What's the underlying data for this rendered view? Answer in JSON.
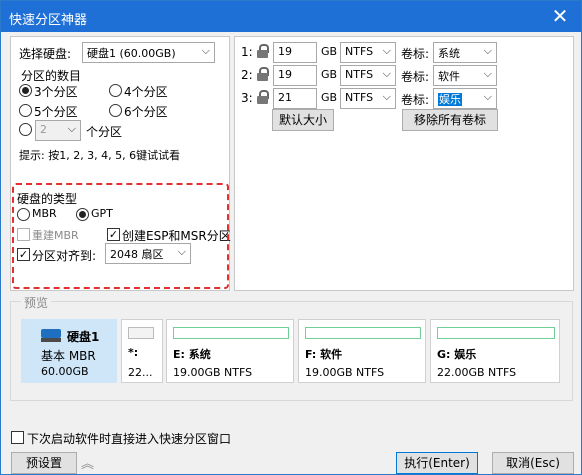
{
  "window": {
    "title": "快速分区神器",
    "close_glyph": "✕"
  },
  "disk_select": {
    "label": "选择硬盘:",
    "value": "硬盘1 (60.00GB)"
  },
  "count": {
    "label": "分区的数目",
    "options": [
      "3个分区",
      "4个分区",
      "5个分区",
      "6个分区"
    ],
    "custom_value": "2",
    "custom_suffix": "个分区",
    "hint": "提示: 按1, 2, 3, 4, 5, 6键试试看"
  },
  "disk_type": {
    "label": "硬盘的类型",
    "mbr": "MBR",
    "gpt": "GPT",
    "rebuild_mbr": "重建MBR",
    "create_esp": "创建ESP和MSR分区",
    "align_label": "分区对齐到:",
    "align_value": "2048 扇区"
  },
  "partitions": {
    "size_unit": "GB",
    "label_caption": "卷标:",
    "rows": [
      {
        "index": "1:",
        "size": "19",
        "fs": "NTFS",
        "label": "系统"
      },
      {
        "index": "2:",
        "size": "19",
        "fs": "NTFS",
        "label": "软件"
      },
      {
        "index": "3:",
        "size": "21",
        "fs": "NTFS",
        "label": "娱乐"
      }
    ],
    "default_size_btn": "默认大小",
    "remove_labels_btn": "移除所有卷标"
  },
  "preview": {
    "label": "预览",
    "disk": {
      "name": "硬盘1",
      "type": "基本 MBR",
      "size": "60.00GB"
    },
    "parts": [
      {
        "name": "*:",
        "size": "22..."
      },
      {
        "name": "E: 系统",
        "size": "19.00GB NTFS"
      },
      {
        "name": "F: 软件",
        "size": "19.00GB NTFS"
      },
      {
        "name": "G: 娱乐",
        "size": "22.00GB NTFS"
      }
    ]
  },
  "footer": {
    "startup_check": "下次启动软件时直接进入快速分区窗口",
    "preset_btn": "预设置",
    "expand_glyph": "︽",
    "execute_btn": "执行(Enter)",
    "cancel_btn": "取消(Esc)"
  },
  "glyphs": {
    "dropdown": "⌵",
    "checkmark": "✓"
  },
  "colors": {
    "titlebar": "#1e6fd6",
    "highlight_label": "#0078d7",
    "disk_card": "#cfe6f8",
    "usage_bar": "#6fcf97"
  }
}
